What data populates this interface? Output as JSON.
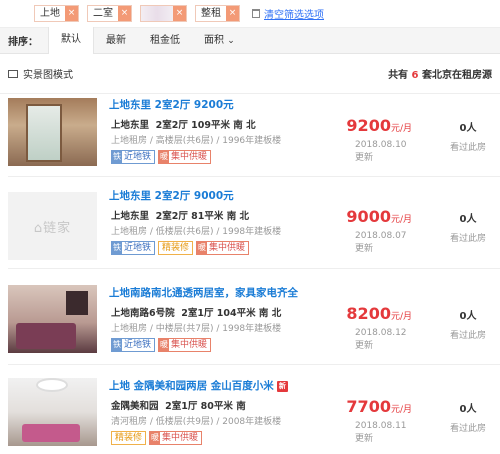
{
  "filters": {
    "tags": [
      {
        "label": "上地",
        "close": "×"
      },
      {
        "label": "二室",
        "close": "×"
      },
      {
        "label": "",
        "close": "×"
      },
      {
        "label": "整租",
        "close": "×"
      }
    ],
    "clear_label": "清空筛选选项"
  },
  "sort": {
    "label": "排序：",
    "options": [
      "默认",
      "最新",
      "租金低",
      "面积"
    ],
    "area_caret": "⌄"
  },
  "mode": {
    "label": "实景图模式",
    "count_prefix": "共有",
    "count_num": "6",
    "count_suffix": "套北京在租房源"
  },
  "listings": [
    {
      "title": "上地东里 2室2厅 9200元",
      "community": "上地东里",
      "specs": "2室2厅 109平米 南 北",
      "sub": "上地租房 / 高楼层(共6层) / 1996年建板楼",
      "tags": [
        {
          "icon": "铁",
          "label": "近地铁",
          "type": "subway"
        },
        {
          "icon": "暖",
          "label": "集中供暖",
          "type": "heat"
        }
      ],
      "price": "9200",
      "unit": "元/月",
      "date": "2018.08.10 更新",
      "viewers": "0人",
      "viewers_label": "看过此房"
    },
    {
      "title": "上地东里 2室2厅 9000元",
      "community": "上地东里",
      "specs": "2室2厅 81平米 南 北",
      "sub": "上地租房 / 低楼层(共6层) / 1998年建板楼",
      "tags": [
        {
          "icon": "铁",
          "label": "近地铁",
          "type": "subway"
        },
        {
          "icon": "",
          "label": "精装修",
          "type": "deco"
        },
        {
          "icon": "暖",
          "label": "集中供暖",
          "type": "heat"
        }
      ],
      "price": "9000",
      "unit": "元/月",
      "date": "2018.08.07 更新",
      "viewers": "0人",
      "viewers_label": "看过此房",
      "placeholder_logo": "⌂链家"
    },
    {
      "title": "上地南路南北通透两居室，家具家电齐全",
      "community": "上地南路6号院",
      "specs": "2室1厅 104平米 南 北",
      "sub": "上地租房 / 中楼层(共7层) / 1998年建板楼",
      "tags": [
        {
          "icon": "铁",
          "label": "近地铁",
          "type": "subway"
        },
        {
          "icon": "暖",
          "label": "集中供暖",
          "type": "heat"
        }
      ],
      "price": "8200",
      "unit": "元/月",
      "date": "2018.08.12 更新",
      "viewers": "0人",
      "viewers_label": "看过此房"
    },
    {
      "title": "上地 金隅美和园两居 金山百度小米",
      "badge": "新",
      "community": "金隅美和园",
      "specs": "2室1厅 80平米 南",
      "sub": "清河租房 / 低楼层(共9层) / 2008年建板楼",
      "tags": [
        {
          "icon": "",
          "label": "精装修",
          "type": "deco"
        },
        {
          "icon": "暖",
          "label": "集中供暖",
          "type": "heat"
        }
      ],
      "price": "7700",
      "unit": "元/月",
      "date": "2018.08.11 更新",
      "viewers": "0人",
      "viewers_label": "看过此房"
    }
  ]
}
